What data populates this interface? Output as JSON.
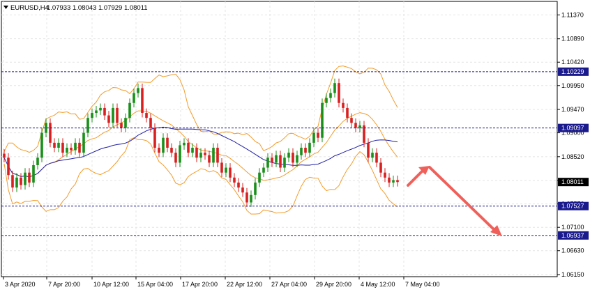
{
  "header": {
    "symbol": "EURUSD,H4",
    "ohlc": "1.07933 1.08043 1.07929 1.08011",
    "menu_icon": "triangle-down-icon"
  },
  "chart_data": {
    "type": "candlestick",
    "symbol": "EURUSD",
    "timeframe": "H4",
    "indicators": [
      "Bollinger Bands",
      "Moving Average"
    ],
    "ylim": [
      1.0615,
      1.116
    ],
    "price_ticks": [
      "1.11370",
      "1.10890",
      "1.10420",
      "1.09950",
      "1.09470",
      "1.09000",
      "1.08520",
      "1.08040",
      "1.07570",
      "1.07100",
      "1.06630",
      "1.06150"
    ],
    "time_labels": [
      "3 Apr 2020",
      "7 Apr 20:00",
      "10 Apr 12:00",
      "15 Apr 04:00",
      "17 Apr 20:00",
      "22 Apr 12:00",
      "27 Apr 04:00",
      "29 Apr 20:00",
      "4 May 12:00",
      "7 May 04:00"
    ],
    "current_price": "1.08011",
    "horizontal_levels": [
      {
        "label": "1.10229",
        "value": 1.10229
      },
      {
        "label": "1.09097",
        "value": 1.09097
      },
      {
        "label": "1.07527",
        "value": 1.07527
      },
      {
        "label": "1.06937",
        "value": 1.06937
      }
    ],
    "closes": [
      1.085,
      1.0815,
      1.079,
      1.081,
      1.0795,
      1.082,
      1.08,
      1.0835,
      1.085,
      1.09,
      1.092,
      1.088,
      1.087,
      1.088,
      1.086,
      1.087,
      1.0865,
      1.088,
      1.086,
      1.09,
      1.093,
      1.094,
      1.0945,
      1.095,
      1.0935,
      1.092,
      1.095,
      1.092,
      1.091,
      1.093,
      1.096,
      1.098,
      1.099,
      1.094,
      1.093,
      1.091,
      1.087,
      1.086,
      1.089,
      1.087,
      1.086,
      1.084,
      1.0875,
      1.088,
      1.086,
      1.087,
      1.085,
      1.086,
      1.0855,
      1.084,
      1.087,
      1.084,
      1.082,
      1.083,
      1.081,
      1.08,
      1.079,
      1.078,
      1.076,
      1.0775,
      1.08,
      1.082,
      1.083,
      1.085,
      1.084,
      1.0855,
      1.083,
      1.085,
      1.086,
      1.084,
      1.0855,
      1.087,
      1.086,
      1.088,
      1.09,
      1.089,
      1.096,
      1.097,
      1.098,
      1.1,
      1.096,
      1.095,
      1.093,
      1.092,
      1.091,
      1.0915,
      1.088,
      1.085,
      1.086,
      1.084,
      1.082,
      1.081,
      1.08,
      1.0805,
      1.0801
    ]
  },
  "colors": {
    "bull_candle": "#1a8f1a",
    "bear_candle": "#d92020",
    "bands": "#f39c2a",
    "moving_average": "#1f1fa6",
    "level_line": "#1a1a8c",
    "level_tag_bg": "#1a1a8c",
    "current_tag_bg": "#000000",
    "arrow": "#f0605a",
    "grid": "#e4e4e4"
  }
}
